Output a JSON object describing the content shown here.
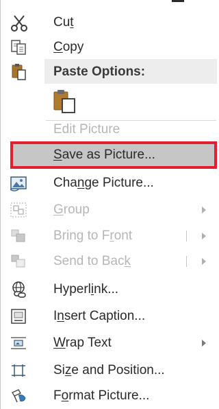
{
  "menu": {
    "cut": {
      "pre": "Cu",
      "key": "t",
      "post": ""
    },
    "copy": {
      "pre": "",
      "key": "C",
      "post": "opy"
    },
    "paste_options": "Paste Options:",
    "edit_picture": "Edit Picture",
    "save_as_picture": {
      "pre": "",
      "key": "S",
      "post": "ave as Picture..."
    },
    "change_picture": {
      "pre": "Cha",
      "key": "n",
      "post": "ge Picture..."
    },
    "group": {
      "pre": "",
      "key": "G",
      "post": "roup"
    },
    "bring_to_front": {
      "pre": "Bring to F",
      "key": "r",
      "post": "ont"
    },
    "send_to_back": {
      "pre": "Send to Bac",
      "key": "k",
      "post": ""
    },
    "hyperlink": {
      "pre": "Hyperl",
      "key": "i",
      "post": "nk..."
    },
    "insert_caption": {
      "pre": "I",
      "key": "n",
      "post": "sert Caption..."
    },
    "wrap_text": {
      "pre": "",
      "key": "W",
      "post": "rap Text"
    },
    "size_and_position": {
      "pre": "Si",
      "key": "z",
      "post": "e and Position..."
    },
    "format_picture": {
      "pre": "F",
      "key": "o",
      "post": "rmat Picture..."
    }
  },
  "colors": {
    "highlight_border": "#e0202e",
    "highlight_fill": "#c6c6c6",
    "disabled_text": "#b6b6b6"
  }
}
